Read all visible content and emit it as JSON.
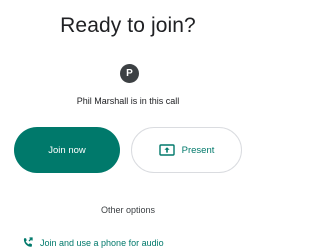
{
  "title": "Ready to join?",
  "participant": {
    "avatar_initial": "P",
    "status": "Phil Marshall is in this call"
  },
  "actions": {
    "join_label": "Join now",
    "present_label": "Present"
  },
  "other_options_label": "Other options",
  "phone_audio_label": "Join and use a phone for audio",
  "colors": {
    "accent": "#00796b",
    "avatar_bg": "#3c4043",
    "text": "#202124"
  },
  "icons": {
    "present": "present-to-all-icon",
    "phone_audio": "phone-forwarded-icon"
  }
}
